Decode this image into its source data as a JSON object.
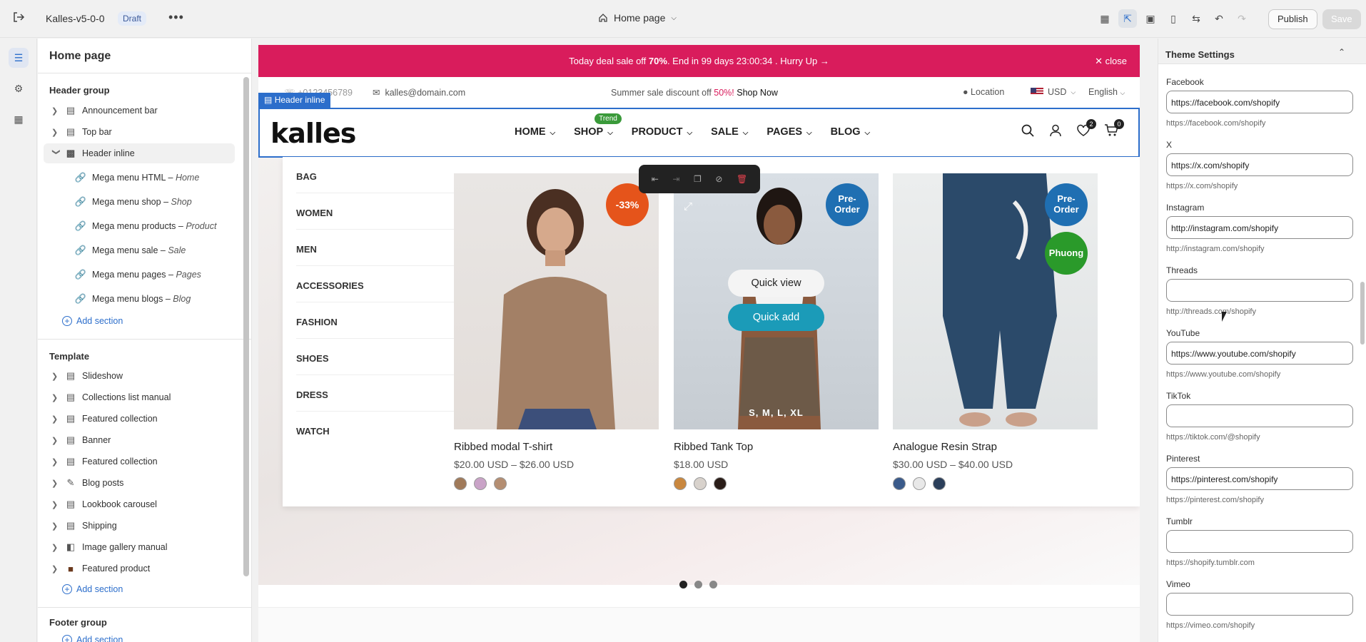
{
  "topbar": {
    "store": "Kalles-v5-0-0",
    "status": "Draft",
    "page": "Home page",
    "publish": "Publish",
    "save": "Save"
  },
  "sidebar": {
    "title": "Home page",
    "header_group": {
      "title": "Header group",
      "items": [
        {
          "label": "Announcement bar"
        },
        {
          "label": "Top bar"
        },
        {
          "label": "Header inline"
        }
      ],
      "sub_items": [
        {
          "label": "Mega menu HTML",
          "sep": " – ",
          "tag": "Home"
        },
        {
          "label": "Mega menu shop",
          "sep": " – ",
          "tag": "Shop"
        },
        {
          "label": "Mega menu products",
          "sep": " – ",
          "tag": "Product"
        },
        {
          "label": "Mega menu sale",
          "sep": " – ",
          "tag": "Sale"
        },
        {
          "label": "Mega menu pages",
          "sep": " – ",
          "tag": "Pages"
        },
        {
          "label": "Mega menu blogs",
          "sep": " – ",
          "tag": "Blog"
        }
      ],
      "add": "Add section"
    },
    "template": {
      "title": "Template",
      "items": [
        {
          "label": "Slideshow"
        },
        {
          "label": "Collections list manual"
        },
        {
          "label": "Featured collection"
        },
        {
          "label": "Banner"
        },
        {
          "label": "Featured collection"
        },
        {
          "label": "Blog posts"
        },
        {
          "label": "Lookbook carousel"
        },
        {
          "label": "Shipping"
        },
        {
          "label": "Image gallery manual"
        },
        {
          "label": "Featured product"
        }
      ],
      "add": "Add section"
    },
    "footer_group": {
      "title": "Footer group",
      "add": "Add section"
    }
  },
  "preview": {
    "announcement": {
      "pre": "Today deal sale off ",
      "bold": "70%",
      "post": ". End in 99 days 23:00:34 .  Hurry Up →",
      "close": "close"
    },
    "topbar": {
      "phone": "+0123456789",
      "email": "kalles@domain.com",
      "sale_pre": "Summer sale discount off ",
      "sale_pct": "50%!",
      "sale_link": "Shop Now",
      "location": "Location",
      "currency": "USD",
      "language": "English"
    },
    "section_tag": "Header inline",
    "logo": "kalles",
    "nav": [
      {
        "label": "HOME"
      },
      {
        "label": "SHOP",
        "badge": "Trend"
      },
      {
        "label": "PRODUCT"
      },
      {
        "label": "SALE"
      },
      {
        "label": "PAGES"
      },
      {
        "label": "BLOG"
      }
    ],
    "wishlist_count": "2",
    "cart_count": "0",
    "categories": [
      "BAG",
      "WOMEN",
      "MEN",
      "ACCESSORIES",
      "FASHION",
      "SHOES",
      "DRESS",
      "WATCH"
    ],
    "products": [
      {
        "name": "Ribbed modal T-shirt",
        "price": "$20.00 USD – $26.00 USD",
        "badge": "-33%",
        "badge_color": "#e5541b"
      },
      {
        "name": "Ribbed Tank Top",
        "price": "$18.00 USD",
        "badge": "Pre-Order",
        "badge_color": "#1f6fb2",
        "quick_view": "Quick view",
        "quick_add": "Quick add",
        "sizes": "S, M, L, XL"
      },
      {
        "name": "Analogue Resin Strap",
        "price": "$30.00 USD – $40.00 USD",
        "badge": "Pre-Order",
        "badge_color": "#1f6fb2",
        "badge2": "Phuong",
        "badge2_color": "#2a9a2a"
      }
    ]
  },
  "theme_settings": {
    "title": "Theme Settings",
    "fields": [
      {
        "label": "Facebook",
        "value": "https://facebook.com/shopify",
        "hint": "https://facebook.com/shopify"
      },
      {
        "label": "X",
        "value": "https://x.com/shopify",
        "hint": "https://x.com/shopify"
      },
      {
        "label": "Instagram",
        "value": "http://instagram.com/shopify",
        "hint": "http://instagram.com/shopify"
      },
      {
        "label": "Threads",
        "value": "",
        "hint": "http://threads.com/shopify"
      },
      {
        "label": "YouTube",
        "value": "https://www.youtube.com/shopify",
        "hint": "https://www.youtube.com/shopify"
      },
      {
        "label": "TikTok",
        "value": "",
        "hint": "https://tiktok.com/@shopify"
      },
      {
        "label": "Pinterest",
        "value": "https://pinterest.com/shopify",
        "hint": "https://pinterest.com/shopify"
      },
      {
        "label": "Tumblr",
        "value": "",
        "hint": "https://shopify.tumblr.com"
      },
      {
        "label": "Vimeo",
        "value": "",
        "hint": "https://vimeo.com/shopify"
      }
    ]
  }
}
